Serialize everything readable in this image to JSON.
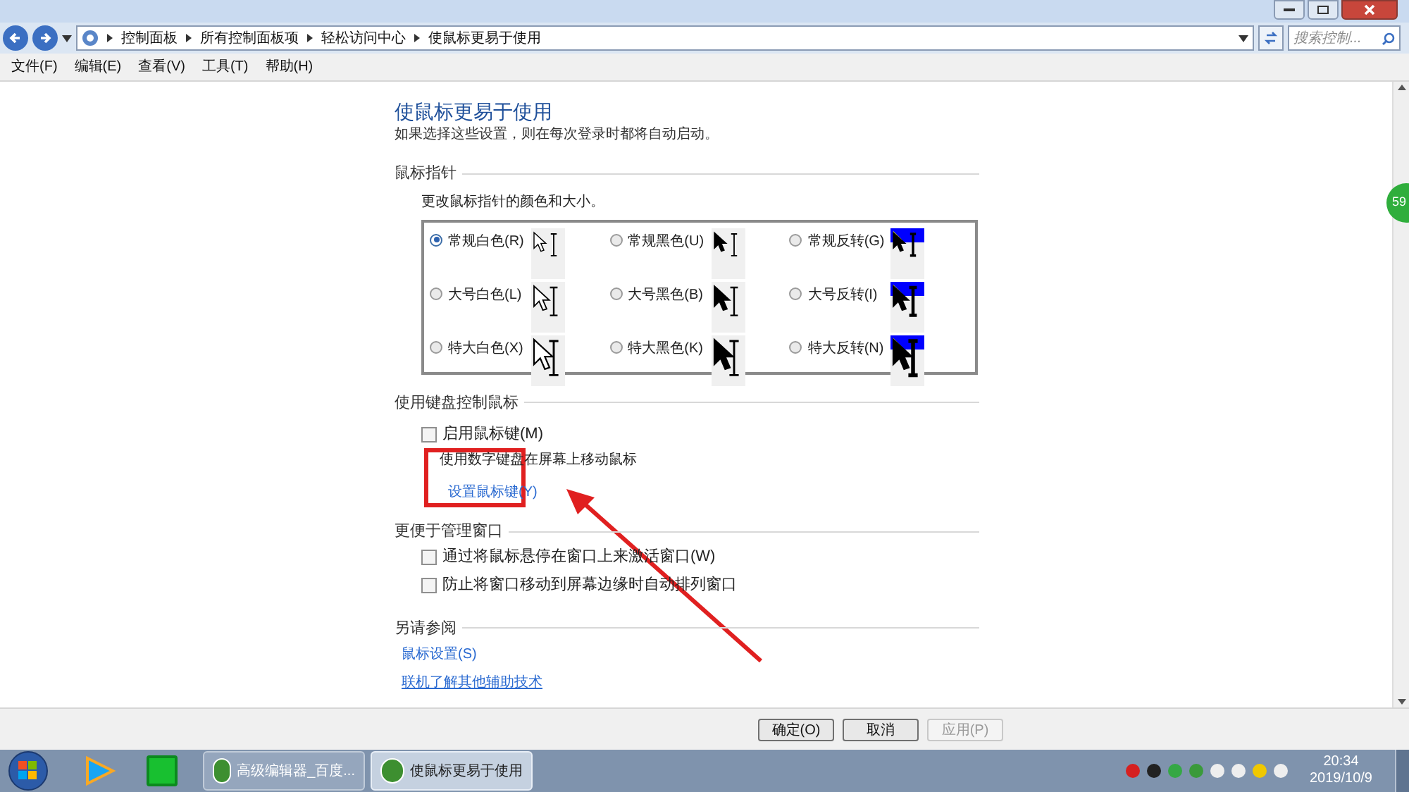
{
  "address_bar": {
    "breadcrumbs": [
      "控制面板",
      "所有控制面板项",
      "轻松访问中心",
      "使鼠标更易于使用"
    ],
    "search_placeholder": "搜索控制..."
  },
  "menu": [
    "文件(F)",
    "编辑(E)",
    "查看(V)",
    "工具(T)",
    "帮助(H)"
  ],
  "page": {
    "title": "使鼠标更易于使用",
    "subtitle": "如果选择这些设置，则在每次登录时都将自动启动。"
  },
  "pointer_section": {
    "heading": "鼠标指针",
    "description": "更改鼠标指针的颜色和大小。",
    "options": [
      {
        "label": "常规白色(R)",
        "selected": true,
        "kind": "white"
      },
      {
        "label": "常规黑色(U)",
        "selected": false,
        "kind": "black"
      },
      {
        "label": "常规反转(G)",
        "selected": false,
        "kind": "inverted"
      },
      {
        "label": "大号白色(L)",
        "selected": false,
        "kind": "white"
      },
      {
        "label": "大号黑色(B)",
        "selected": false,
        "kind": "black"
      },
      {
        "label": "大号反转(I)",
        "selected": false,
        "kind": "inverted"
      },
      {
        "label": "特大白色(X)",
        "selected": false,
        "kind": "white"
      },
      {
        "label": "特大黑色(K)",
        "selected": false,
        "kind": "black"
      },
      {
        "label": "特大反转(N)",
        "selected": false,
        "kind": "inverted"
      }
    ]
  },
  "keyboard_section": {
    "heading": "使用键盘控制鼠标",
    "checkbox": {
      "label": "启用鼠标键(M)",
      "checked": false
    },
    "note": "使用数字键盘在屏幕上移动鼠标",
    "link": "设置鼠标键(Y)"
  },
  "window_section": {
    "heading": "更便于管理窗口",
    "checkboxes": [
      {
        "label": "通过将鼠标悬停在窗口上来激活窗口(W)",
        "checked": false
      },
      {
        "label": "防止将窗口移动到屏幕边缘时自动排列窗口",
        "checked": false
      }
    ]
  },
  "see_also": {
    "heading": "另请参阅",
    "links": [
      "鼠标设置(S)",
      "联机了解其他辅助技术"
    ]
  },
  "edge_badge": "59",
  "buttons": [
    {
      "label": "确定(O)",
      "disabled": false
    },
    {
      "label": "取消",
      "disabled": false
    },
    {
      "label": "应用(P)",
      "disabled": true
    }
  ],
  "taskbar": {
    "tasks": [
      {
        "label": "高级编辑器_百度...",
        "active": false
      },
      {
        "label": "使鼠标更易于使用",
        "active": true
      }
    ],
    "time": "20:34",
    "date": "2019/10/9"
  }
}
